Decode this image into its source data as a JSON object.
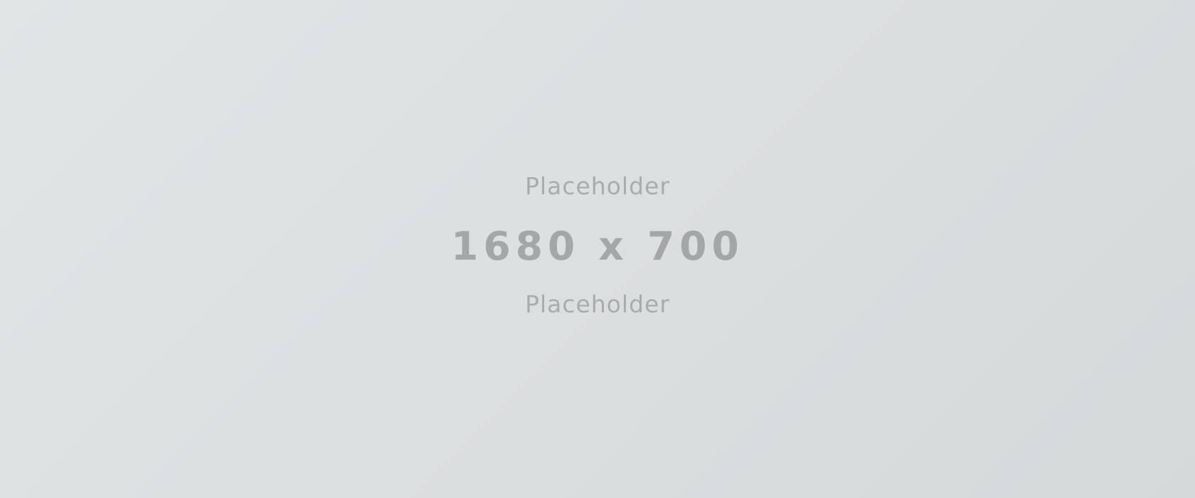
{
  "placeholder": {
    "top_text": "Placeholder",
    "size_text": "1680 x 700",
    "bottom_text": "Placeholder"
  },
  "colors": {
    "background_start": "#e1e5e6",
    "background_end": "#d5d9da",
    "text": "#a9acad"
  }
}
